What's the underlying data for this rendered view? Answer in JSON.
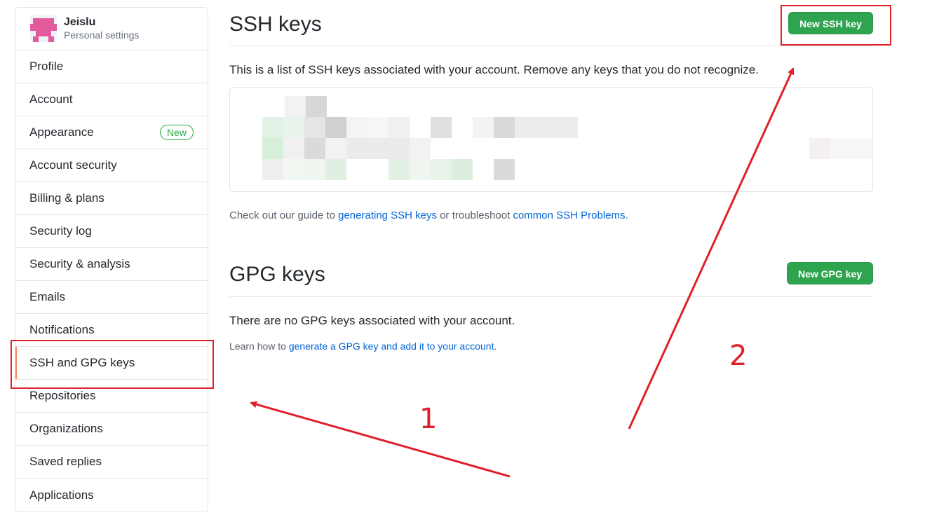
{
  "profile": {
    "name": "Jeislu",
    "subtitle": "Personal settings"
  },
  "sidebar": {
    "items": [
      {
        "label": "Profile"
      },
      {
        "label": "Account"
      },
      {
        "label": "Appearance",
        "badge": "New"
      },
      {
        "label": "Account security"
      },
      {
        "label": "Billing & plans"
      },
      {
        "label": "Security log"
      },
      {
        "label": "Security & analysis"
      },
      {
        "label": "Emails"
      },
      {
        "label": "Notifications"
      },
      {
        "label": "SSH and GPG keys",
        "selected": true
      },
      {
        "label": "Repositories"
      },
      {
        "label": "Organizations"
      },
      {
        "label": "Saved replies"
      },
      {
        "label": "Applications"
      }
    ]
  },
  "ssh": {
    "title": "SSH keys",
    "new_button": "New SSH key",
    "description": "This is a list of SSH keys associated with your account. Remove any keys that you do not recognize.",
    "guide_prefix": "Check out our guide to",
    "guide_link": "generating SSH keys",
    "guide_middle": "or troubleshoot",
    "problems_link": "common SSH Problems",
    "guide_suffix": "."
  },
  "gpg": {
    "title": "GPG keys",
    "new_button": "New GPG key",
    "empty_text": "There are no GPG keys associated with your account.",
    "learn_prefix": "Learn how to",
    "learn_link": "generate a GPG key and add it to your account",
    "learn_suffix": "."
  },
  "annotations": {
    "label_1": "1",
    "label_2": "2",
    "color": "#e0202a"
  },
  "colors": {
    "accent_green": "#2ea44f",
    "link_blue": "#0366d6",
    "selected_indicator": "#f9826c"
  }
}
